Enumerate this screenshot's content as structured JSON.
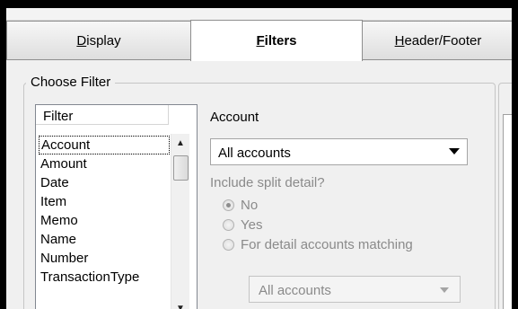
{
  "tabs": [
    {
      "label": "Display",
      "hotkey": "D",
      "rest": "isplay"
    },
    {
      "label": "Filters",
      "hotkey": "F",
      "rest": "ilters"
    },
    {
      "label": "Header/Footer",
      "hotkey": "H",
      "rest": "eader/Footer"
    }
  ],
  "choose_filter": {
    "group_label": "Choose Filter",
    "list_header": "Filter",
    "items": [
      "Account",
      "Amount",
      "Date",
      "Item",
      "Memo",
      "Name",
      "Number",
      "TransactionType"
    ],
    "selected": "Account"
  },
  "account": {
    "label": "Account",
    "value": "All accounts",
    "split_label": "Include split detail?",
    "options": [
      "No",
      "Yes",
      "For detail accounts matching"
    ],
    "selected_option": "No",
    "matching_value": "All accounts"
  }
}
